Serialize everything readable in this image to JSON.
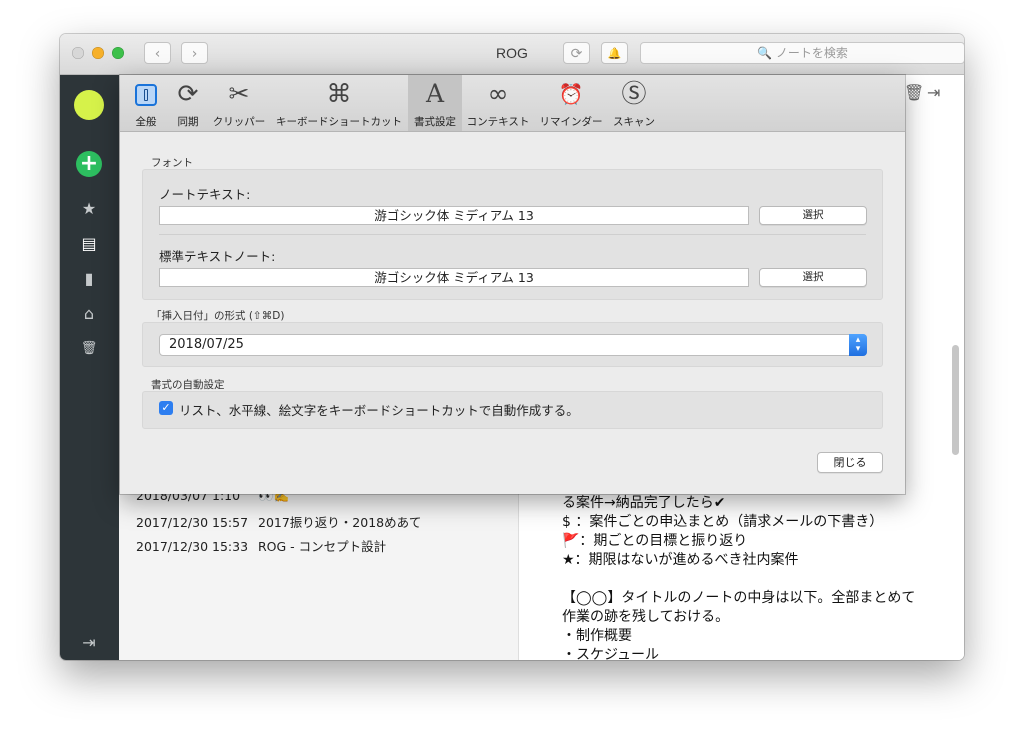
{
  "window": {
    "title": "ROG",
    "nav_back": "‹",
    "nav_forward": "›",
    "sync_icon": "⟳",
    "bell_icon": "🔔",
    "search_placeholder": "🔍 ノートを検索"
  },
  "sidebar": {
    "new_icon": "+",
    "items": [
      {
        "icon": "★",
        "name": "shortcuts"
      },
      {
        "icon": "▤",
        "name": "notes"
      },
      {
        "icon": "▮",
        "name": "notebooks"
      },
      {
        "icon": "⌂",
        "name": "shared"
      },
      {
        "icon": "🗑",
        "name": "trash"
      }
    ],
    "bottom_icon": "⇥"
  },
  "note_list": {
    "rows": [
      {
        "date": "2018/03/07 1:10",
        "title": "👀✍️"
      },
      {
        "date": "2017/12/30 15:57",
        "title": "2017振り返り・2018めあて"
      },
      {
        "date": "2017/12/30 15:33",
        "title": "ROG - コンセプト設計"
      }
    ]
  },
  "editor": {
    "lines": [
      "る案件→納品完了したら✔",
      "$ ：案件ごとの申込まとめ（請求メールの下書き）",
      "🚩：期ごとの目標と振り返り",
      "★：期限はないが進めるべき社内案件",
      "",
      "【◯◯】タイトルのノートの中身は以下。全部まとめて",
      "作業の跡を残しておける。",
      "・制作概要",
      "・スケジュール"
    ]
  },
  "prefs": {
    "tabs": [
      {
        "label": "全般",
        "icon": "general"
      },
      {
        "label": "同期",
        "icon": "⟳"
      },
      {
        "label": "クリッパー",
        "icon": "✂"
      },
      {
        "label": "キーボードショートカット",
        "icon": "⌘"
      },
      {
        "label": "書式設定",
        "icon": "A"
      },
      {
        "label": "コンテキスト",
        "icon": "∞"
      },
      {
        "label": "リマインダー",
        "icon": "⏰"
      },
      {
        "label": "スキャン",
        "icon": "Ⓢ"
      }
    ],
    "font_section": "フォント",
    "note_text_label": "ノートテキスト:",
    "note_text_font": "游ゴシック体 ミディアム 13",
    "select_label": "選択",
    "plain_text_label": "標準テキストノート:",
    "plain_text_font": "游ゴシック体 ミディアム 13",
    "date_section": "「挿入日付」の形式 (⇧⌘D)",
    "date_format": "2018/07/25",
    "auto_section": "書式の自動設定",
    "auto_checkbox_label": "リスト、水平線、絵文字をキーボードショートカットで自動作成する。",
    "auto_checkbox_checked": true,
    "close_label": "閉じる"
  }
}
